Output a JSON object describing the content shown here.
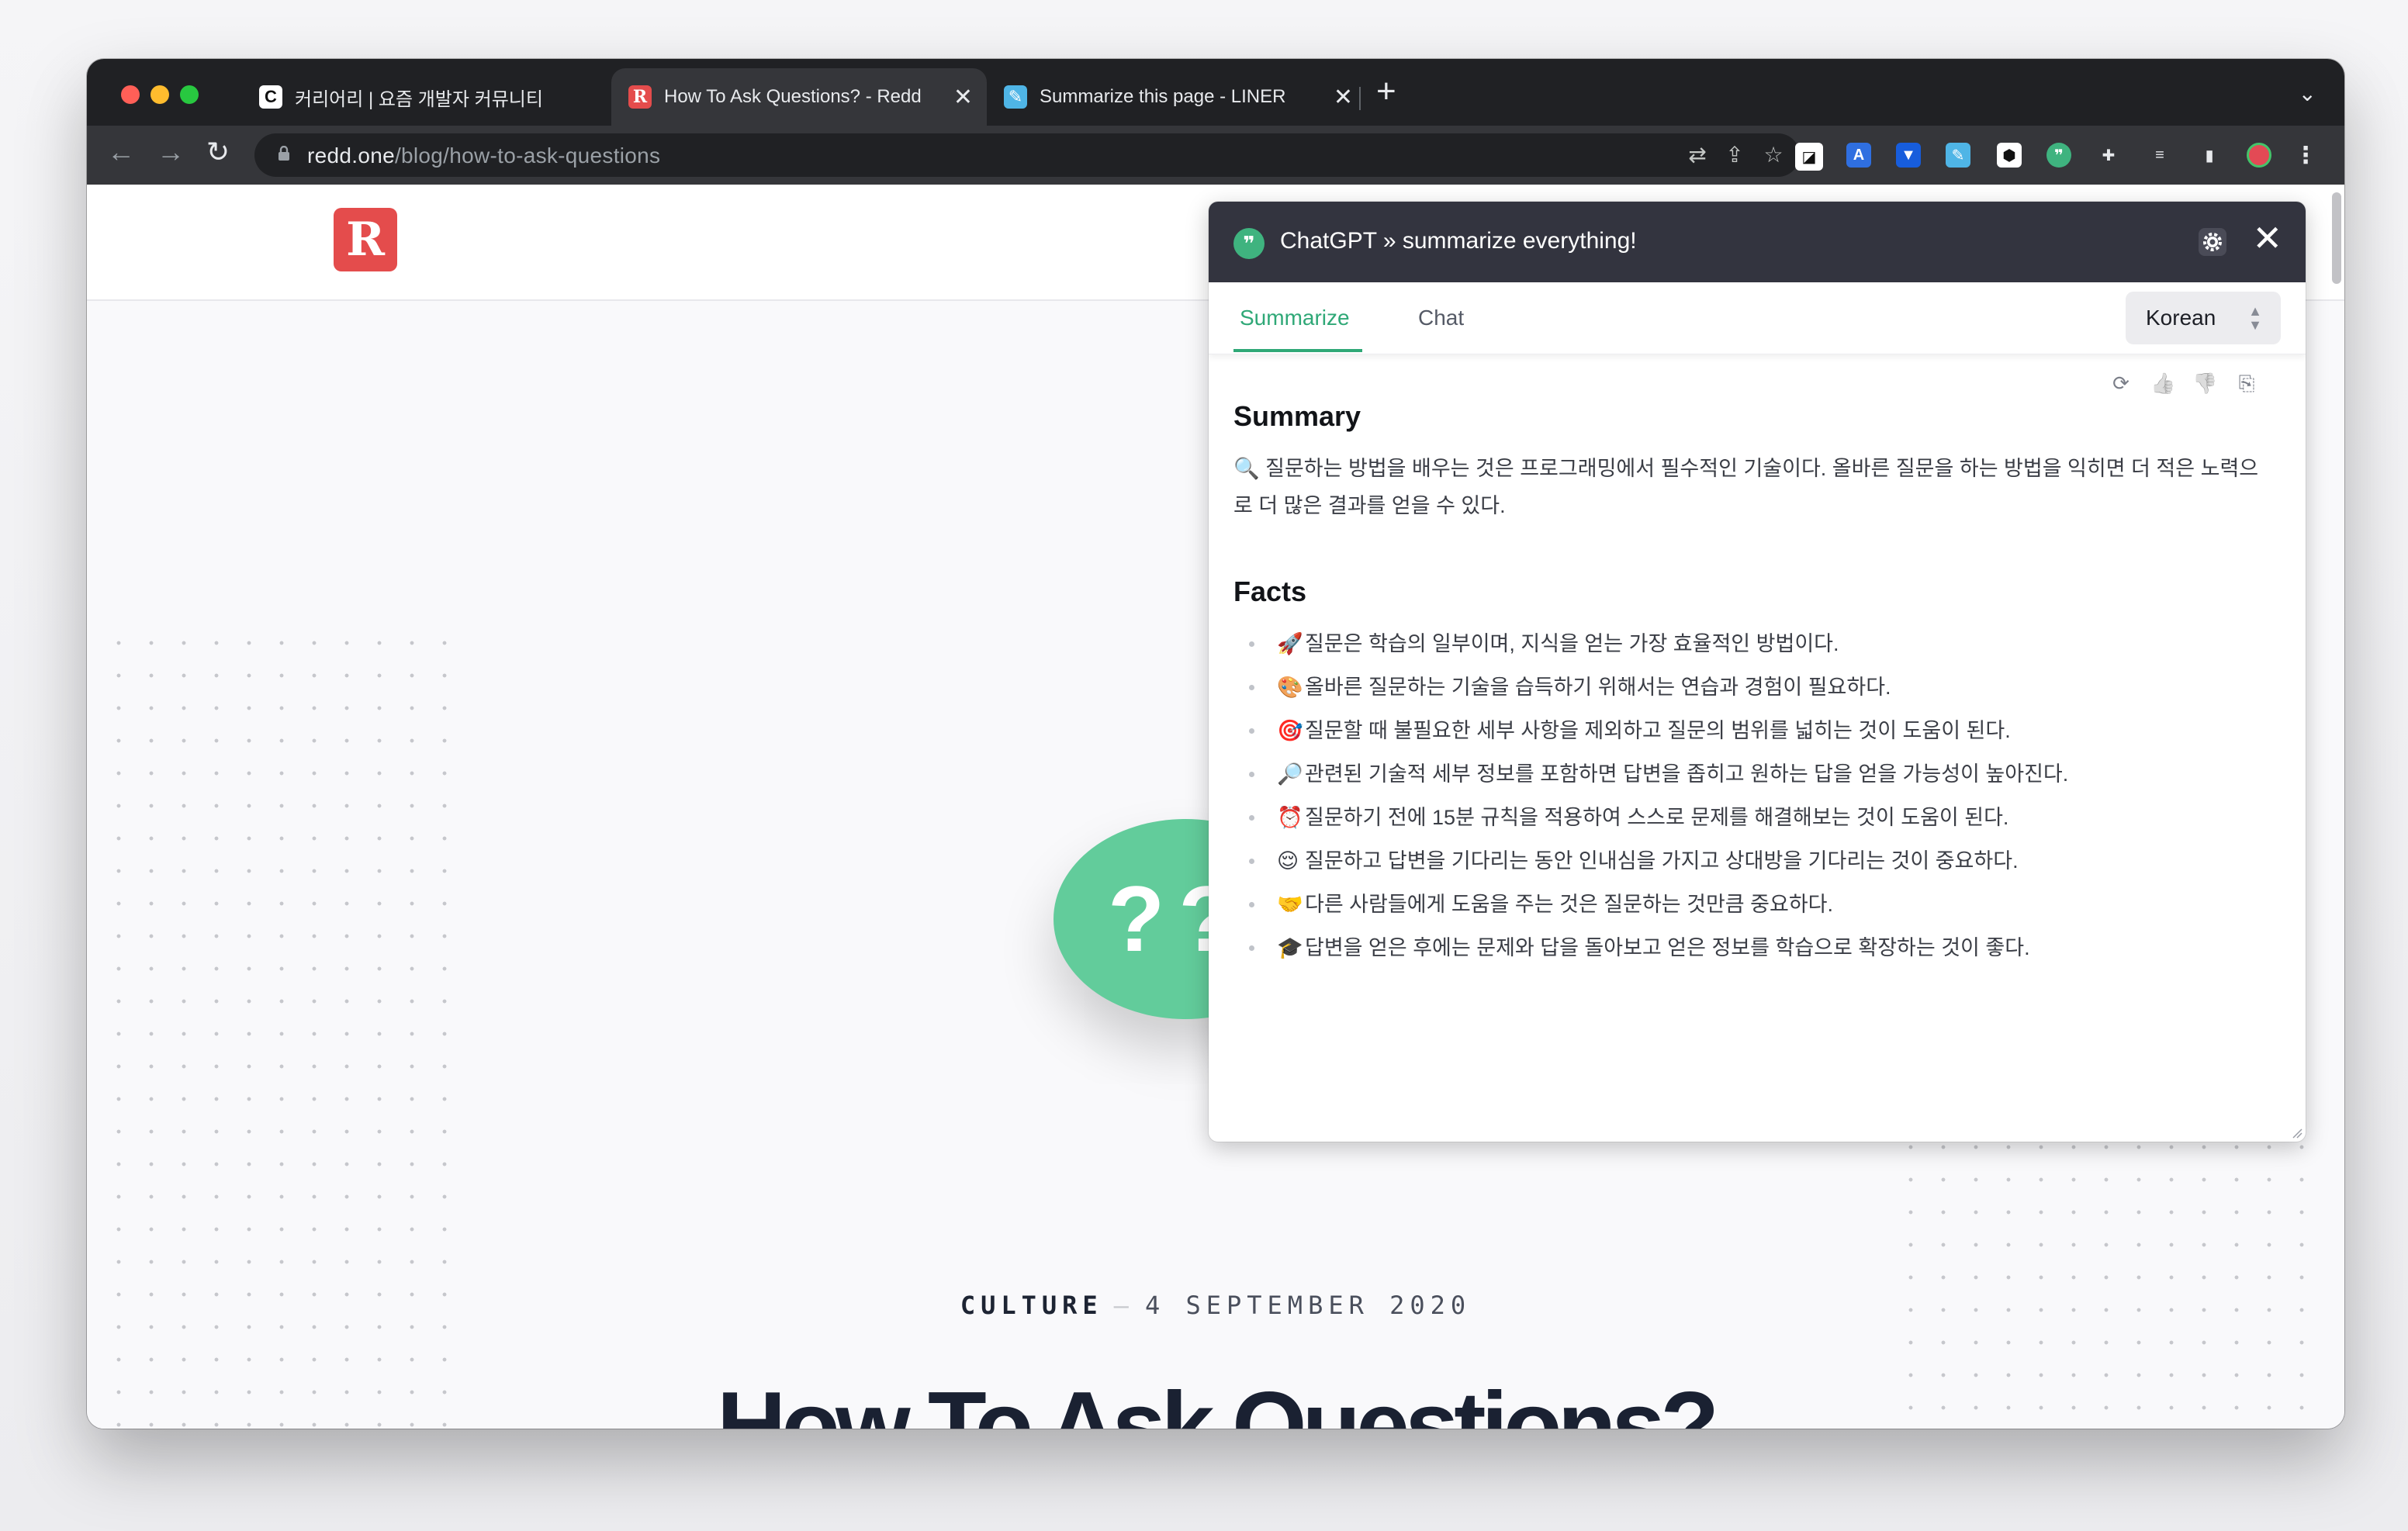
{
  "tabs": [
    {
      "title": "커리어리 | 요즘 개발자 커뮤니티",
      "favicon_text": "C"
    },
    {
      "title": "How To Ask Questions? - Redd",
      "favicon_text": "R"
    },
    {
      "title": "Summarize this page - LINER",
      "favicon_text": "✎"
    }
  ],
  "new_tab_glyph": "+",
  "tab_close_glyph": "✕",
  "address": {
    "host": "redd.one",
    "path": "/blog/how-to-ask-questions"
  },
  "page": {
    "logo_letter": "R",
    "bubble_text": "??",
    "category": "CULTURE",
    "separator": "—",
    "date": "4 SEPTEMBER 2020",
    "headline": "How To Ask Questions?"
  },
  "panel": {
    "title": "ChatGPT » summarize everything!",
    "badge_glyph": "❞",
    "close_glyph": "✕",
    "tabs": {
      "summarize": "Summarize",
      "chat": "Chat"
    },
    "language": "Korean",
    "summary_heading": "Summary",
    "summary_text": "🔍 질문하는 방법을 배우는 것은 프로그래밍에서 필수적인 기술이다. 올바른 질문을 하는 방법을 익히면 더 적은 노력으로 더 많은 결과를 얻을 수 있다.",
    "facts_heading": "Facts",
    "facts": [
      {
        "emoji": "🚀",
        "text": "질문은 학습의 일부이며, 지식을 얻는 가장 효율적인 방법이다."
      },
      {
        "emoji": "🎨",
        "text": "올바른 질문하는 기술을 습득하기 위해서는 연습과 경험이 필요하다."
      },
      {
        "emoji": "🎯",
        "text": "질문할 때 불필요한 세부 사항을 제외하고 질문의 범위를 넓히는 것이 도움이 된다."
      },
      {
        "emoji": "🔎",
        "text": "관련된 기술적 세부 정보를 포함하면 답변을 좁히고 원하는 답을 얻을 가능성이 높아진다."
      },
      {
        "emoji": "⏰",
        "text": "질문하기 전에 15분 규칙을 적용하여 스스로 문제를 해결해보는 것이 도움이 된다."
      },
      {
        "emoji": "😌",
        "text": "질문하고 답변을 기다리는 동안 인내심을 가지고 상대방을 기다리는 것이 중요하다."
      },
      {
        "emoji": "🤝",
        "text": "다른 사람들에게 도움을 주는 것은 질문하는 것만큼 중요하다."
      },
      {
        "emoji": "🎓",
        "text": "답변을 얻은 후에는 문제와 답을 돌아보고 얻은 정보를 학습으로 확장하는 것이 좋다."
      }
    ]
  },
  "colors": {
    "accent": "#2fa877",
    "bubble": "#62cc9b",
    "logo": "#e44c4c",
    "panel_header": "#33343f"
  },
  "icons": {
    "back": "←",
    "forward": "→",
    "reload": "↻",
    "translate": "⇄",
    "share": "⇪",
    "star": "☆",
    "refresh": "⟳",
    "thumbs_up": "👍",
    "thumbs_down": "👎",
    "copy": "⎘",
    "menu": "⋮",
    "chevron": "⌄",
    "puzzle": "✚",
    "sidebar": "▮"
  }
}
